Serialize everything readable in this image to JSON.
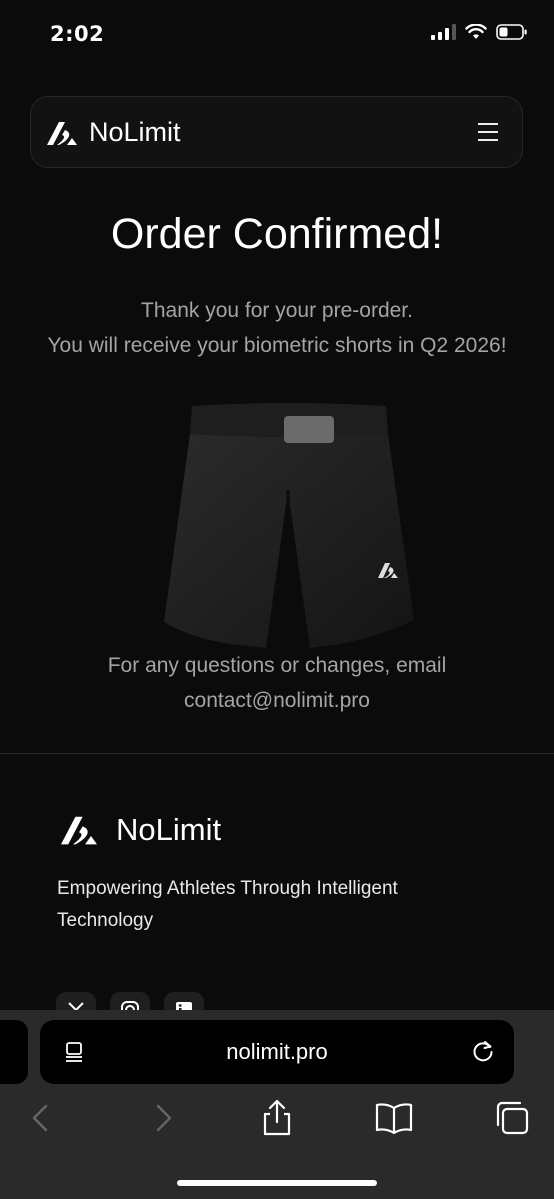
{
  "status_bar": {
    "time": "2:02"
  },
  "header": {
    "brand": "NoLimit",
    "menu_icon": "hamburger-menu-icon"
  },
  "main": {
    "title": "Order Confirmed!",
    "message_line1": "Thank you for your pre-order.",
    "message_line2": "You will receive your biometric shorts in Q2 2026!",
    "contact_line1": "For any questions or changes, email",
    "contact_email": "contact@nolimit.pro"
  },
  "footer": {
    "brand": "NoLimit",
    "tagline": "Empowering Athletes Through Intelligent Technology",
    "socials": [
      "x-icon",
      "instagram-icon",
      "linkedin-icon"
    ]
  },
  "browser": {
    "url": "nolimit.pro",
    "toolbar": [
      "back-icon",
      "forward-icon",
      "share-icon",
      "bookmarks-icon",
      "tabs-icon"
    ]
  },
  "colors": {
    "background": "#0b0b0b",
    "muted_text": "#a4a4a4",
    "browser_chrome": "#2a2a2a"
  }
}
